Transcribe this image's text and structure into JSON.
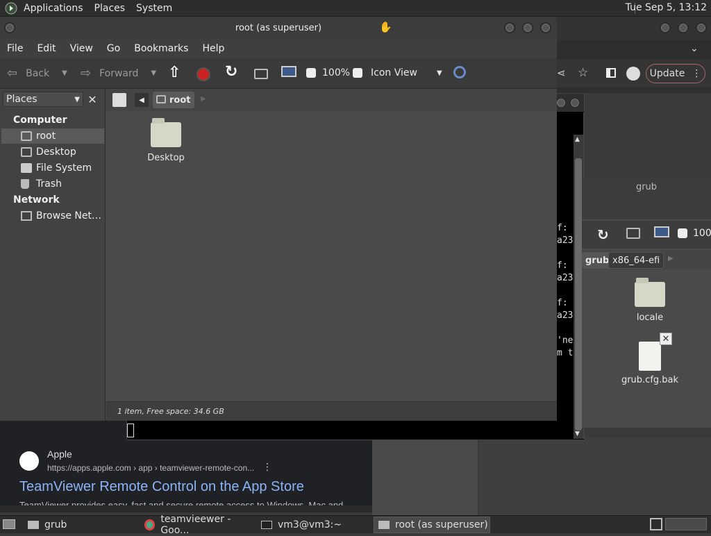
{
  "top_panel": {
    "menus": [
      "Applications",
      "Places",
      "System"
    ],
    "clock": "Tue Sep  5, 13:12"
  },
  "browser": {
    "update_label": "Update"
  },
  "search_result": {
    "source": "Apple",
    "url": "https://apps.apple.com › app › teamviewer-remote-con...",
    "title": "TeamViewer Remote Control on the App Store",
    "snippet": "TeamViewer provides easy, fast and secure remote access to Windows, Mac and"
  },
  "terminal": {
    "lines": [
      "f:",
      "a23",
      "",
      "f:",
      "a23",
      "",
      "f:",
      "a23",
      "",
      "'ne",
      "m t"
    ]
  },
  "grub_window": {
    "title": "grub",
    "zoom": "100",
    "path": [
      "grub",
      "x86_64-efi"
    ],
    "items": [
      {
        "name": "locale",
        "type": "folder"
      },
      {
        "name": "grub.cfg.bak",
        "type": "file"
      }
    ]
  },
  "root_window": {
    "title": "root (as superuser)",
    "menu": [
      "File",
      "Edit",
      "View",
      "Go",
      "Bookmarks",
      "Help"
    ],
    "toolbar": {
      "back": "Back",
      "forward": "Forward",
      "zoom": "100%",
      "view_mode": "Icon View"
    },
    "sidebar": {
      "combo": "Places",
      "sections": [
        {
          "heading": "Computer",
          "items": [
            "root",
            "Desktop",
            "File System",
            "Trash"
          ]
        },
        {
          "heading": "Network",
          "items": [
            "Browse Net…"
          ]
        }
      ]
    },
    "path": [
      "root"
    ],
    "files": [
      {
        "name": "Desktop",
        "type": "folder"
      }
    ],
    "status": "1 item, Free space: 34.6 GB"
  },
  "taskbar": {
    "tasks": [
      "grub",
      "teamvieewer - Goo...",
      "vm3@vm3:~",
      "root (as superuser)"
    ]
  },
  "colors": {
    "panel": "#2d2d2d",
    "window": "#474747",
    "link": "#8ab4f8",
    "stop": "#cc2222"
  }
}
